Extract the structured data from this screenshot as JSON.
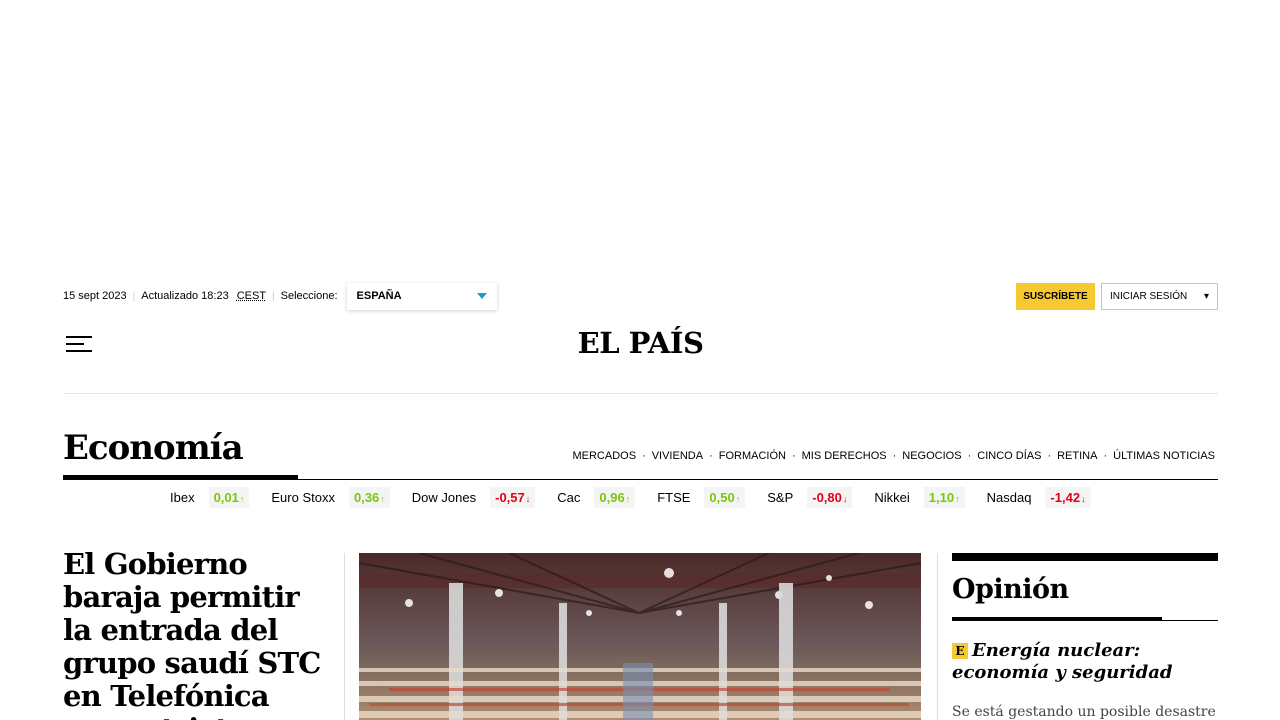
{
  "topbar": {
    "date": "15 sept 2023",
    "updated": "Actualizado 18:23",
    "tz": "CEST",
    "select_label": "Seleccione:",
    "edition": "ESPAÑA",
    "subscribe": "SUSCRÍBETE",
    "login": "INICIAR SESIÓN",
    "login_caret": "▾"
  },
  "masthead": {
    "logo": "EL PAÍS"
  },
  "section": {
    "title": "Economía",
    "nav": [
      "MERCADOS",
      "VIVIENDA",
      "FORMACIÓN",
      "MIS DERECHOS",
      "NEGOCIOS",
      "CINCO DÍAS",
      "RETINA",
      "ÚLTIMAS NOTICIAS"
    ],
    "nav_separator": "·"
  },
  "tickers": [
    {
      "name": "Ibex",
      "value": "0,01",
      "dir": "up"
    },
    {
      "name": "Euro Stoxx",
      "value": "0,36",
      "dir": "up"
    },
    {
      "name": "Dow Jones",
      "value": "-0,57",
      "dir": "down"
    },
    {
      "name": "Cac",
      "value": "0,96",
      "dir": "up"
    },
    {
      "name": "FTSE",
      "value": "0,50",
      "dir": "up"
    },
    {
      "name": "S&P",
      "value": "-0,80",
      "dir": "down"
    },
    {
      "name": "Nikkei",
      "value": "1,10",
      "dir": "up"
    },
    {
      "name": "Nasdaq",
      "value": "-1,42",
      "dir": "down"
    }
  ],
  "lead": {
    "headline": "El Gobierno baraja permitir la entrada del grupo saudí STC en Telefónica con estrictas"
  },
  "opinion": {
    "title": "Opinión",
    "badge": "E",
    "headline": "Energía nuclear: economía y seguridad",
    "excerpt": "Se está gestando un posible desastre a"
  },
  "colors": {
    "accent_yellow": "#f6c933",
    "up": "#7ac70c",
    "down": "#e3001b",
    "edition_caret": "#1a9bd7"
  }
}
